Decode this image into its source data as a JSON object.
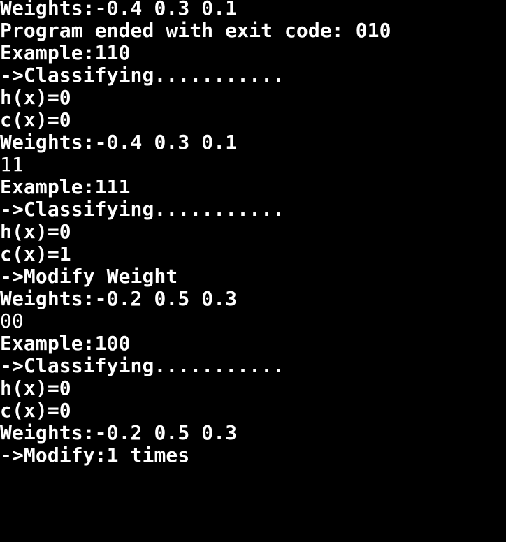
{
  "terminal": {
    "background": "#000000",
    "foreground": "#ffffff",
    "lines": [
      {
        "text": "Weights:-0.4 0.3 0.1",
        "kind": "output"
      },
      {
        "text": "Program ended with exit code: 010",
        "kind": "output"
      },
      {
        "text": "Example:110",
        "kind": "output"
      },
      {
        "text": "->Classifying...........",
        "kind": "output"
      },
      {
        "text": "h(x)=0",
        "kind": "output"
      },
      {
        "text": "c(x)=0",
        "kind": "output"
      },
      {
        "text": "Weights:-0.4 0.3 0.1",
        "kind": "output"
      },
      {
        "text": "11",
        "kind": "input"
      },
      {
        "text": "Example:111",
        "kind": "output"
      },
      {
        "text": "->Classifying...........",
        "kind": "output"
      },
      {
        "text": "h(x)=0",
        "kind": "output"
      },
      {
        "text": "c(x)=1",
        "kind": "output"
      },
      {
        "text": "->Modify Weight",
        "kind": "output"
      },
      {
        "text": "Weights:-0.2 0.5 0.3",
        "kind": "output"
      },
      {
        "text": "00",
        "kind": "input"
      },
      {
        "text": "Example:100",
        "kind": "output"
      },
      {
        "text": "->Classifying...........",
        "kind": "output"
      },
      {
        "text": "h(x)=0",
        "kind": "output"
      },
      {
        "text": "c(x)=0",
        "kind": "output"
      },
      {
        "text": "Weights:-0.2 0.5 0.3",
        "kind": "output"
      },
      {
        "text": "->Modify:1 times",
        "kind": "output"
      }
    ]
  }
}
